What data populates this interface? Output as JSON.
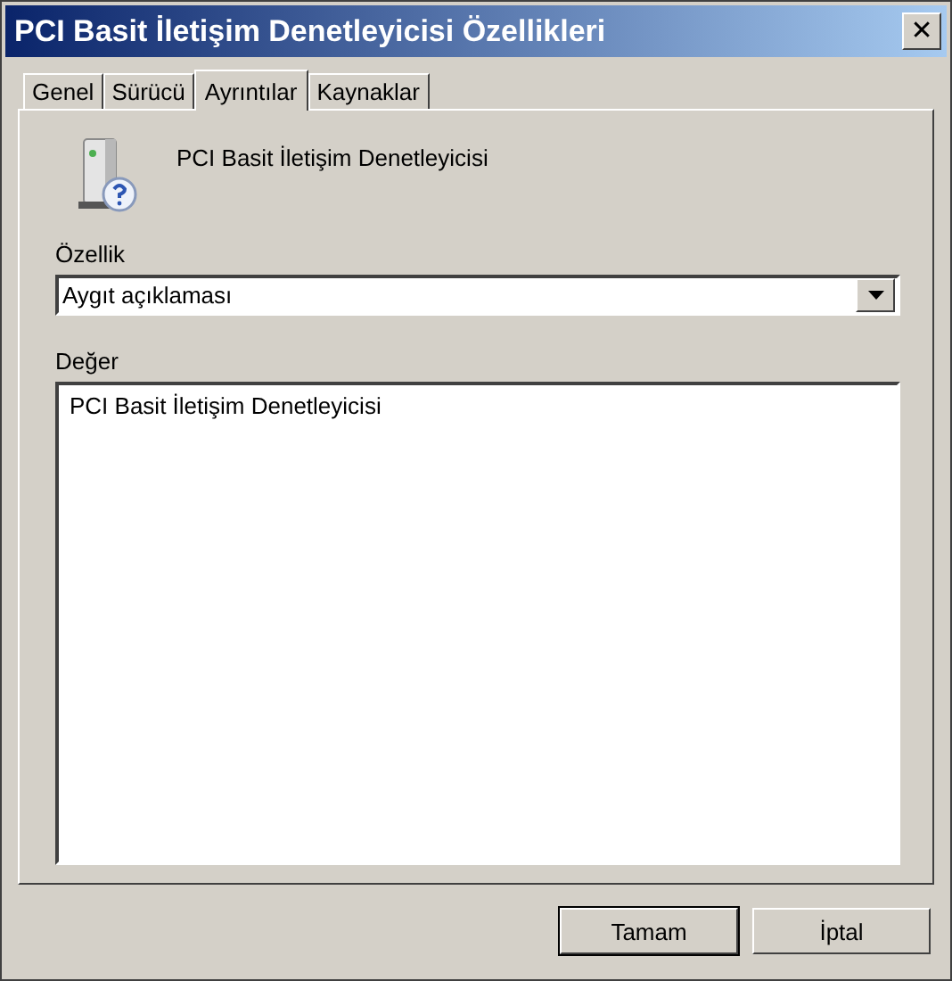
{
  "window": {
    "title": "PCI Basit İletişim Denetleyicisi Özellikleri",
    "close": "✕"
  },
  "tabs": [
    {
      "label": "Genel",
      "selected": false
    },
    {
      "label": "Sürücü",
      "selected": false
    },
    {
      "label": "Ayrıntılar",
      "selected": true
    },
    {
      "label": "Kaynaklar",
      "selected": false
    }
  ],
  "device_name": "PCI Basit İletişim Denetleyicisi",
  "property": {
    "label": "Özellik",
    "value": "Aygıt açıklaması"
  },
  "value": {
    "label": "Değer",
    "items": [
      "PCI Basit İletişim Denetleyicisi"
    ]
  },
  "buttons": [
    {
      "label": "Tamam",
      "default": true
    },
    {
      "label": "İptal",
      "default": false
    }
  ]
}
